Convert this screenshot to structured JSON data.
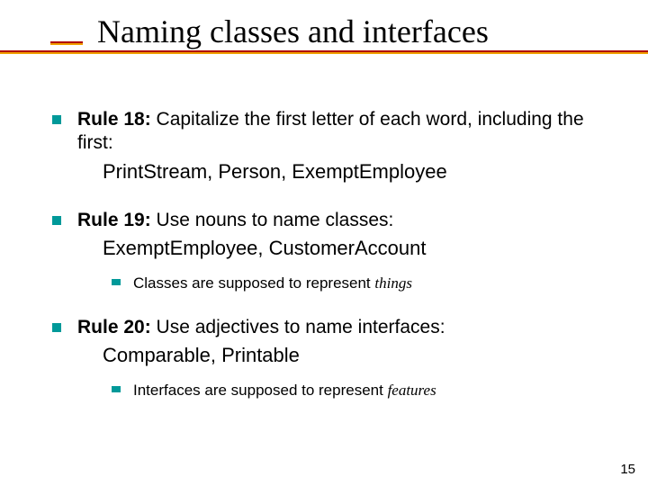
{
  "title": "Naming classes and interfaces",
  "rules": [
    {
      "label": "Rule 18:",
      "text": " Capitalize the first letter of each word, including the first:",
      "examples": "PrintStream, Person, ExemptEmployee"
    },
    {
      "label": "Rule 19:",
      "text": " Use nouns to name classes:",
      "examples": "ExemptEmployee, CustomerAccount",
      "sub": {
        "lead": "Classes are supposed to represent ",
        "em": "things"
      }
    },
    {
      "label": "Rule 20:",
      "text": " Use adjectives to name interfaces:",
      "examples": "Comparable, Printable",
      "sub": {
        "lead": "Interfaces are supposed to represent ",
        "em": "features"
      }
    }
  ],
  "page_number": "15"
}
